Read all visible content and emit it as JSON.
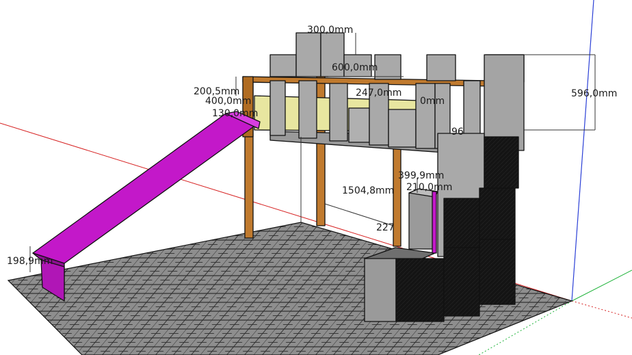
{
  "app": "SketchUp",
  "scene": "loft bed with slide, castle-style battlements and stair storage blocks",
  "colors": {
    "background": "#ffffff",
    "floor_tile": "#8e8e8e",
    "floor_grout": "#2c2c2c",
    "wall_panel": "#a9a9a9",
    "wall_panel_dark": "#8a8a8a",
    "wood_post": "#c07a2e",
    "wood_post_shade": "#8f5618",
    "slide": "#c318c9",
    "slide_dark": "#8e0f93",
    "mattress": "#e8e6a0",
    "cube_black": "#111111",
    "axis_red": "#d62020",
    "axis_green": "#1fb33a",
    "axis_blue": "#2a3fd6"
  },
  "dimensions": [
    {
      "id": "d-300",
      "text": "300,0mm"
    },
    {
      "id": "d-600",
      "text": "600,0mm"
    },
    {
      "id": "d-200",
      "text": "200,5mm"
    },
    {
      "id": "d-400",
      "text": "400,0mm"
    },
    {
      "id": "d-130",
      "text": "130,0mm"
    },
    {
      "id": "d-247",
      "text": "247,0mm"
    },
    {
      "id": "d-596",
      "text": "596,0mm"
    },
    {
      "id": "d-1504",
      "text": "1504,8mm"
    },
    {
      "id": "d-399",
      "text": "399,9mm"
    },
    {
      "id": "d-210",
      "text": "210,0mm"
    },
    {
      "id": "d-227",
      "text": "227"
    },
    {
      "id": "d-198",
      "text": "198,9mm"
    },
    {
      "id": "d-0mm",
      "text": "0mm"
    },
    {
      "id": "d-96",
      "text": "96"
    }
  ]
}
